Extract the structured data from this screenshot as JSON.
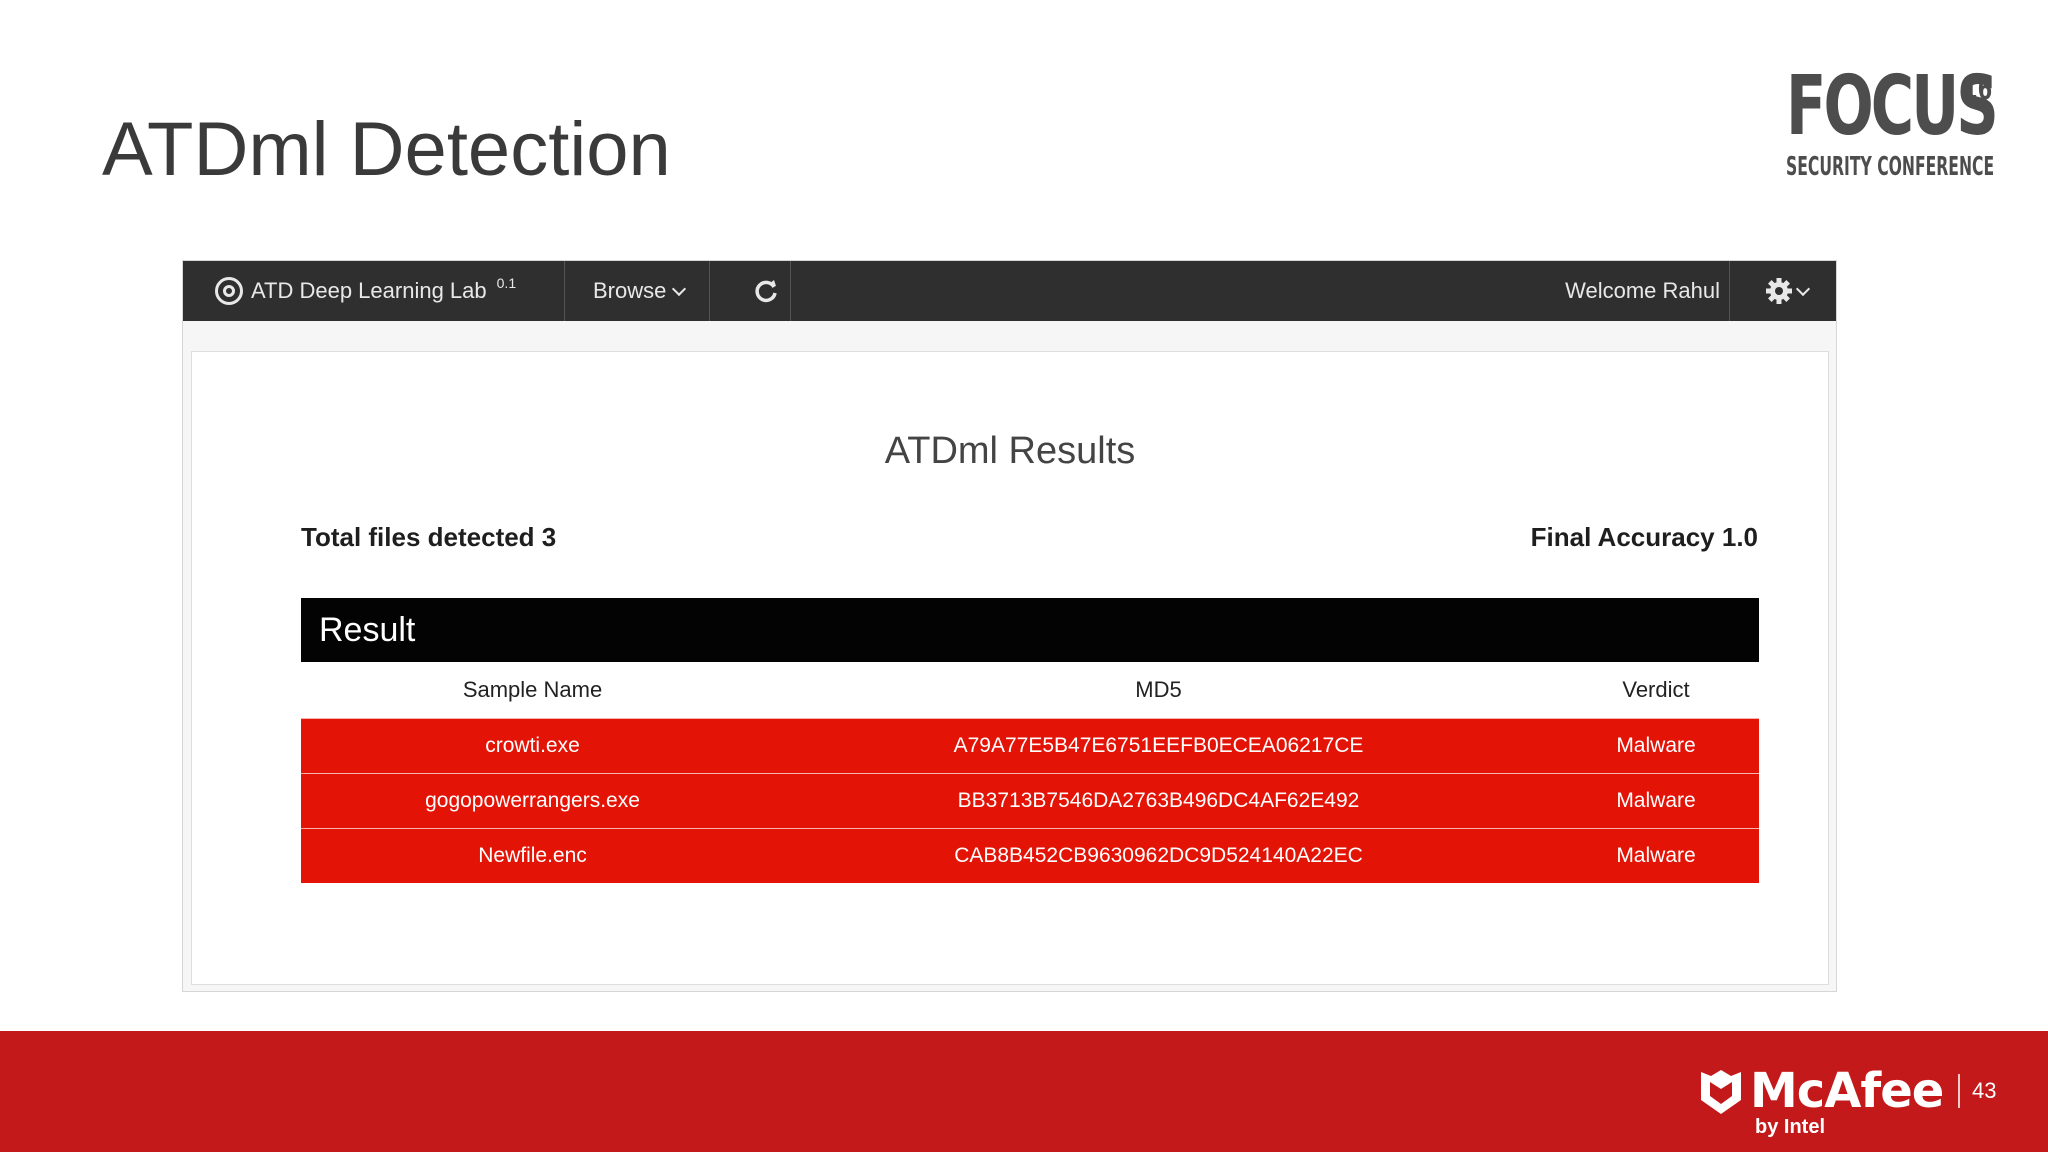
{
  "slide": {
    "title": "ATDml Detection",
    "page_number": "43",
    "logo_focus": {
      "word": "FOCUS",
      "edition": "16",
      "subtitle": "SECURITY CONFERENCE"
    },
    "logo_mcafee": {
      "word": "McAfee",
      "sub": "by Intel"
    },
    "accent_color": "#c3191b"
  },
  "app": {
    "brand": {
      "name": "ATD Deep Learning Lab",
      "version": "0.1",
      "icon": "target-icon"
    },
    "nav": {
      "browse_label": "Browse",
      "refresh_icon": "refresh-icon",
      "welcome": "Welcome Rahul",
      "settings_icon": "gear-icon"
    },
    "results": {
      "title": "ATDml Results",
      "total_files": "Total files detected 3",
      "accuracy": "Final Accuracy 1.0",
      "section_label": "Result",
      "columns": [
        "Sample Name",
        "MD5",
        "Verdict"
      ],
      "rows": [
        [
          "crowti.exe",
          "A79A77E5B47E6751EEFB0ECEA06217CE",
          "Malware"
        ],
        [
          "gogopowerrangers.exe",
          "BB3713B7546DA2763B496DC4AF62E492",
          "Malware"
        ],
        [
          "Newfile.enc",
          "CAB8B452CB9630962DC9D524140A22EC",
          "Malware"
        ]
      ],
      "row_color": "#e31306"
    }
  }
}
